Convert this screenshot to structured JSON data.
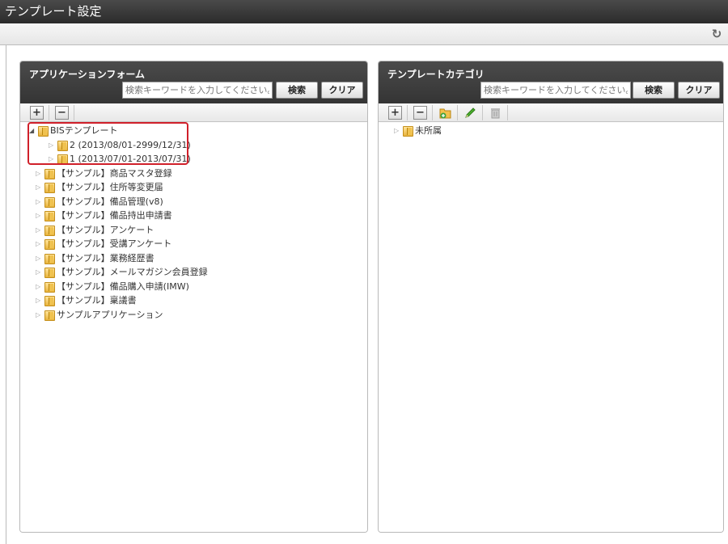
{
  "window": {
    "title": "テンプレート設定"
  },
  "left_panel": {
    "title": "アプリケーションフォーム",
    "search_placeholder": "検索キーワードを入力してください。",
    "search_button": "検索",
    "clear_button": "クリア",
    "tree": [
      {
        "label": "BISテンプレート",
        "expanded": true,
        "children": [
          {
            "label": "2 (2013/08/01-2999/12/31)"
          },
          {
            "label": "1 (2013/07/01-2013/07/31)"
          }
        ]
      },
      {
        "label": "【サンプル】商品マスタ登録"
      },
      {
        "label": "【サンプル】住所等変更届"
      },
      {
        "label": "【サンプル】備品管理(v8)"
      },
      {
        "label": "【サンプル】備品持出申請書"
      },
      {
        "label": "【サンプル】アンケート"
      },
      {
        "label": "【サンプル】受講アンケート"
      },
      {
        "label": "【サンプル】業務経歴書"
      },
      {
        "label": "【サンプル】メールマガジン会員登録"
      },
      {
        "label": "【サンプル】備品購入申請(IMW)"
      },
      {
        "label": "【サンプル】稟議書"
      },
      {
        "label": "サンプルアプリケーション"
      }
    ]
  },
  "right_panel": {
    "title": "テンプレートカテゴリ",
    "search_placeholder": "検索キーワードを入力してください。",
    "search_button": "検索",
    "clear_button": "クリア",
    "tree": [
      {
        "label": "未所属"
      }
    ]
  },
  "icons": {
    "refresh": "refresh-icon",
    "expand_all": "plus-icon",
    "collapse_all": "minus-icon",
    "add_folder": "add-folder-icon",
    "edit": "pencil-icon",
    "delete": "trash-icon"
  },
  "colors": {
    "titlebar": "#333333",
    "panel_header": "#3d3d3d",
    "highlight_border": "#d0202a",
    "folder": "#f0c24f"
  }
}
